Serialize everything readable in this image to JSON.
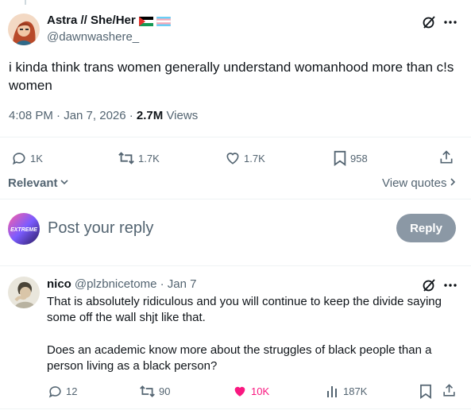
{
  "tweet": {
    "author_name": "Astra // She/Her",
    "handle": "@dawnwashere_",
    "text": "i kinda think trans women generally understand womanhood more than c!s women",
    "time": "4:08 PM · Jan 7, 2026 · ",
    "views_count": "2.7M",
    "views_label": " Views",
    "stats": {
      "replies": "1K",
      "reposts": "1.7K",
      "likes": "1.7K",
      "bookmarks": "958"
    }
  },
  "filters": {
    "relevant_label": "Relevant",
    "view_quotes_label": "View quotes"
  },
  "composer": {
    "placeholder": "Post your reply",
    "reply_button": "Reply",
    "avatar_text": "EXTREME"
  },
  "reply": {
    "author_name": "nico",
    "handle_date": "@plzbnicetome · Jan 7",
    "text_p1": "That is absolutely ridiculous and you will continue to keep the divide saying some off the wall shjt like that.",
    "text_p2": "Does an academic know more about the struggles of black people than a person living as a black person?",
    "stats": {
      "replies": "12",
      "reposts": "90",
      "likes": "10K",
      "views": "187K"
    }
  },
  "colors": {
    "text_primary": "#0f1419",
    "text_secondary": "#536471",
    "like_active": "#f91880",
    "reply_button_bg": "#8b98a5"
  }
}
